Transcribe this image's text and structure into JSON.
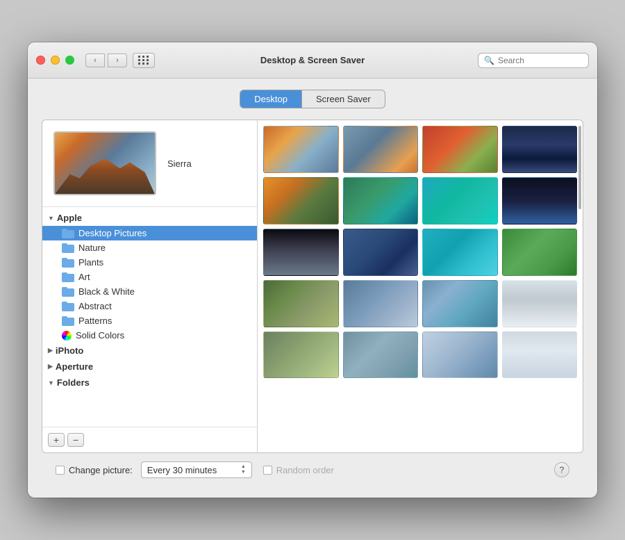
{
  "window": {
    "title": "Desktop & Screen Saver",
    "traffic_lights": {
      "close_label": "close",
      "minimize_label": "minimize",
      "maximize_label": "maximize"
    }
  },
  "titlebar": {
    "nav_back_label": "‹",
    "nav_forward_label": "›",
    "search_placeholder": "Search"
  },
  "tabs": {
    "desktop_label": "Desktop",
    "screen_saver_label": "Screen Saver"
  },
  "preview": {
    "name": "Sierra"
  },
  "sidebar": {
    "apple_label": "Apple",
    "items": [
      {
        "label": "Desktop Pictures",
        "type": "folder",
        "selected": false
      },
      {
        "label": "Nature",
        "type": "folder",
        "selected": false
      },
      {
        "label": "Plants",
        "type": "folder",
        "selected": false
      },
      {
        "label": "Art",
        "type": "folder",
        "selected": false
      },
      {
        "label": "Black & White",
        "type": "folder",
        "selected": false
      },
      {
        "label": "Abstract",
        "type": "folder",
        "selected": false
      },
      {
        "label": "Patterns",
        "type": "folder",
        "selected": false
      },
      {
        "label": "Solid Colors",
        "type": "color",
        "selected": false
      }
    ],
    "iphoto_label": "iPhoto",
    "aperture_label": "Aperture",
    "folders_label": "Folders",
    "add_button": "+",
    "remove_button": "−"
  },
  "bottom_bar": {
    "change_picture_label": "Change picture:",
    "interval_label": "Every 30 minutes",
    "random_order_label": "Random order",
    "help_label": "?"
  }
}
